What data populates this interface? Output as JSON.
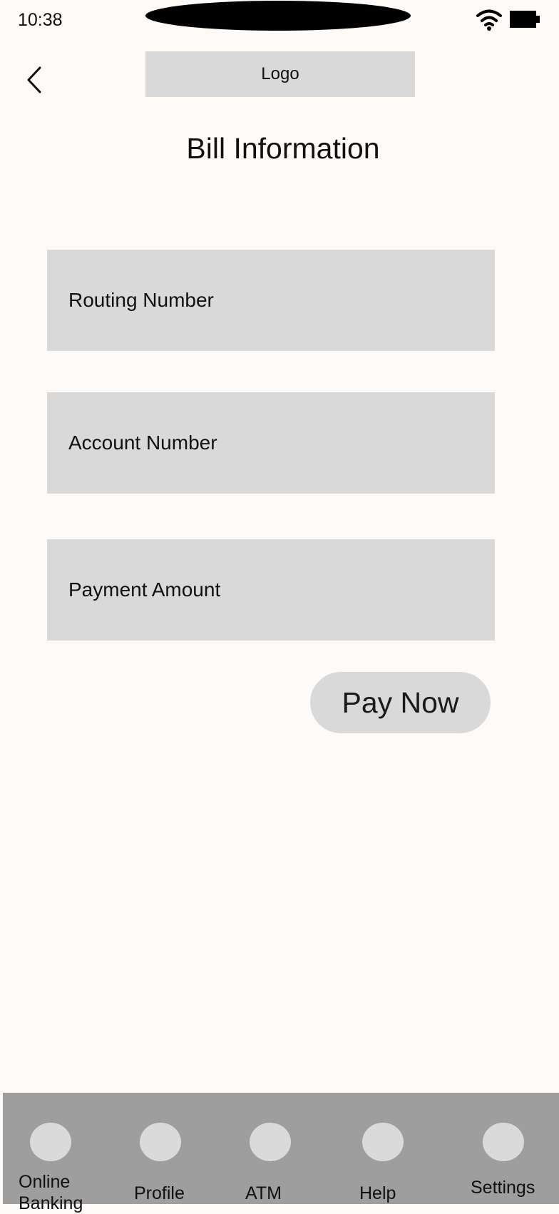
{
  "status_bar": {
    "time": "10:38",
    "icons": [
      "wifi-icon",
      "battery-icon"
    ]
  },
  "header": {
    "back_icon": "chevron-left-icon",
    "logo_label": "Logo",
    "title": "Bill Information"
  },
  "form": {
    "routing_placeholder": "Routing Number",
    "account_placeholder": "Account Number",
    "amount_placeholder": "Payment Amount",
    "submit_label": "Pay Now"
  },
  "bottom_nav": {
    "items": [
      {
        "label_line1": "Online",
        "label_line2": "Banking"
      },
      {
        "label": "Profile"
      },
      {
        "label": "ATM"
      },
      {
        "label": "Help"
      },
      {
        "label": "Settings"
      }
    ]
  },
  "colors": {
    "background": "#fdfaf8",
    "placeholder_fill": "#d9d9d9",
    "nav_background": "#9e9e9e"
  }
}
